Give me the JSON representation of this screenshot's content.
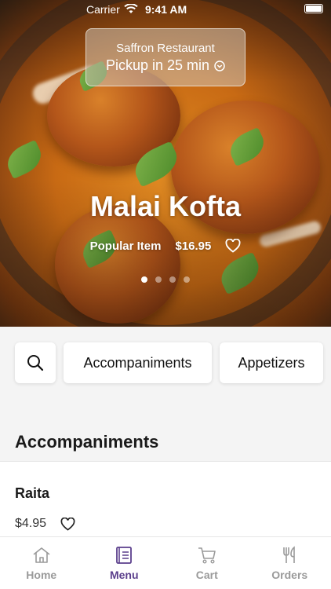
{
  "status_bar": {
    "carrier": "Carrier",
    "time": "9:41 AM"
  },
  "hero": {
    "restaurant_name": "Saffron Restaurant",
    "pickup_text": "Pickup in 25 min",
    "dish_title": "Malai Kofta",
    "badge": "Popular Item",
    "price": "$16.95",
    "carousel_pages": 4,
    "carousel_active": 1
  },
  "categories": {
    "search_icon": "search-icon",
    "items": [
      "Accompaniments",
      "Appetizers"
    ]
  },
  "section": {
    "title": "Accompaniments"
  },
  "menu_items": [
    {
      "name": "Raita",
      "price": "$4.95"
    }
  ],
  "tab_bar": {
    "tabs": [
      {
        "label": "Home",
        "icon": "home-icon",
        "active": false
      },
      {
        "label": "Menu",
        "icon": "menu-book-icon",
        "active": true
      },
      {
        "label": "Cart",
        "icon": "cart-icon",
        "active": false
      },
      {
        "label": "Orders",
        "icon": "utensils-icon",
        "active": false
      }
    ]
  },
  "colors": {
    "accent": "#5b3f8c",
    "inactive": "#9a9a9a"
  }
}
